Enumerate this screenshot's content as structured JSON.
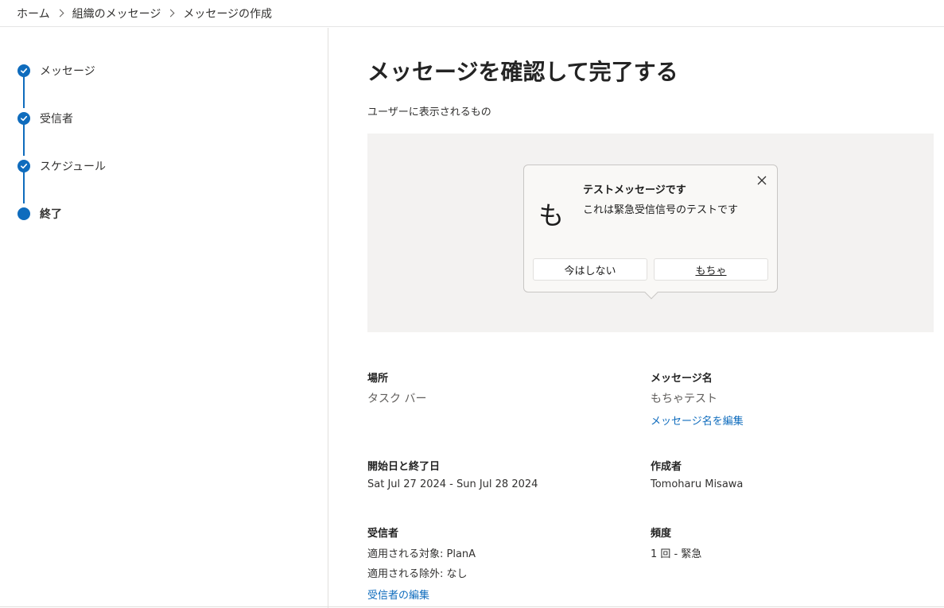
{
  "breadcrumb": {
    "items": [
      "ホーム",
      "組織のメッセージ",
      "メッセージの作成"
    ]
  },
  "steps": [
    {
      "label": "メッセージ",
      "state": "complete"
    },
    {
      "label": "受信者",
      "state": "complete"
    },
    {
      "label": "スケジュール",
      "state": "complete"
    },
    {
      "label": "終了",
      "state": "current"
    }
  ],
  "main": {
    "title": "メッセージを確認して完了する",
    "subtitle": "ユーザーに表示されるもの"
  },
  "preview": {
    "icon_char": "も",
    "title": "テストメッセージです",
    "body": "これは緊急受信信号のテストです",
    "dismiss_button": "今はしない",
    "action_button": "もちゃ"
  },
  "details": {
    "location": {
      "label": "場所",
      "value": "タスク バー"
    },
    "message_name": {
      "label": "メッセージ名",
      "value": "もちゃテスト",
      "edit_link": "メッセージ名を編集"
    },
    "dates": {
      "label": "開始日と終了日",
      "value": "Sat Jul 27 2024 - Sun Jul 28 2024"
    },
    "author": {
      "label": "作成者",
      "value": "Tomoharu Misawa"
    },
    "recipients": {
      "label": "受信者",
      "applies_to": "適用される対象: PlanA",
      "excludes": "適用される除外: なし",
      "edit_link": "受信者の編集"
    },
    "frequency": {
      "label": "頻度",
      "value": "1 回 - 緊急"
    }
  },
  "colors": {
    "accent": "#0f6cbd",
    "preview_bg": "#f3f2f1"
  }
}
